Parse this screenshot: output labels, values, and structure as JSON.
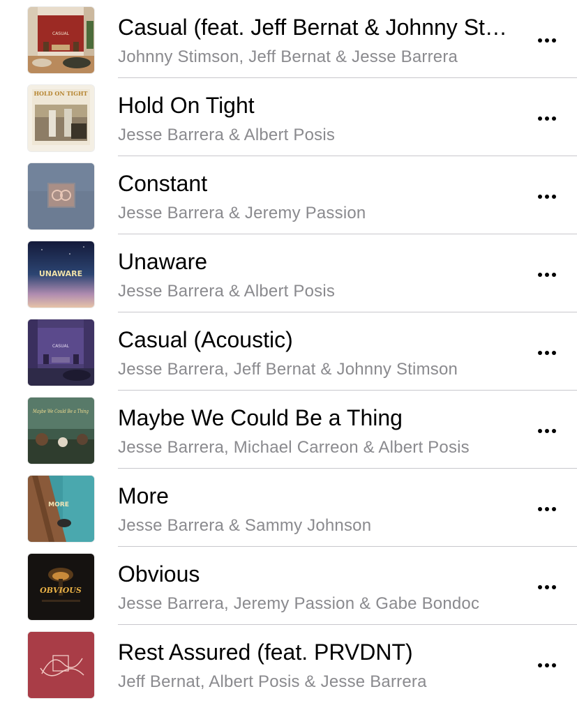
{
  "songs": [
    {
      "title": "Casual (feat. Jeff Bernat & Johnny Stimson)",
      "artist": "Johnny Stimson, Jeff Bernat & Jesse Barrera",
      "art": "casual-red-room",
      "art_text": "CASUAL"
    },
    {
      "title": "Hold On Tight",
      "artist": "Jesse Barrera & Albert Posis",
      "art": "hold-on-tight-photo",
      "art_text": "HOLD ON TIGHT"
    },
    {
      "title": "Constant",
      "artist": "Jesse Barrera & Jeremy Passion",
      "art": "constant-blue-gray",
      "art_text": ""
    },
    {
      "title": "Unaware",
      "artist": "Jesse Barrera & Albert Posis",
      "art": "unaware-night-sky",
      "art_text": "UNAWARE"
    },
    {
      "title": "Casual (Acoustic)",
      "artist": "Jesse Barrera, Jeff Bernat & Johnny Stimson",
      "art": "casual-purple-room",
      "art_text": "CASUAL"
    },
    {
      "title": "Maybe We Could Be a Thing",
      "artist": "Jesse Barrera, Michael Carreon & Albert Posis",
      "art": "maybe-thing-outdoor",
      "art_text": "Maybe We Could Be a Thing"
    },
    {
      "title": "More",
      "artist": "Jesse Barrera & Sammy Johnson",
      "art": "more-teal",
      "art_text": "MORE"
    },
    {
      "title": "Obvious",
      "artist": "Jesse Barrera, Jeremy Passion & Gabe Bondoc",
      "art": "obvious-dark",
      "art_text": "OBVIOUS"
    },
    {
      "title": "Rest Assured (feat. PRVDNT)",
      "artist": "Jeff Bernat, Albert Posis & Jesse Barrera",
      "art": "rest-assured-red",
      "art_text": ""
    }
  ],
  "more_icon": "ellipsis-icon"
}
